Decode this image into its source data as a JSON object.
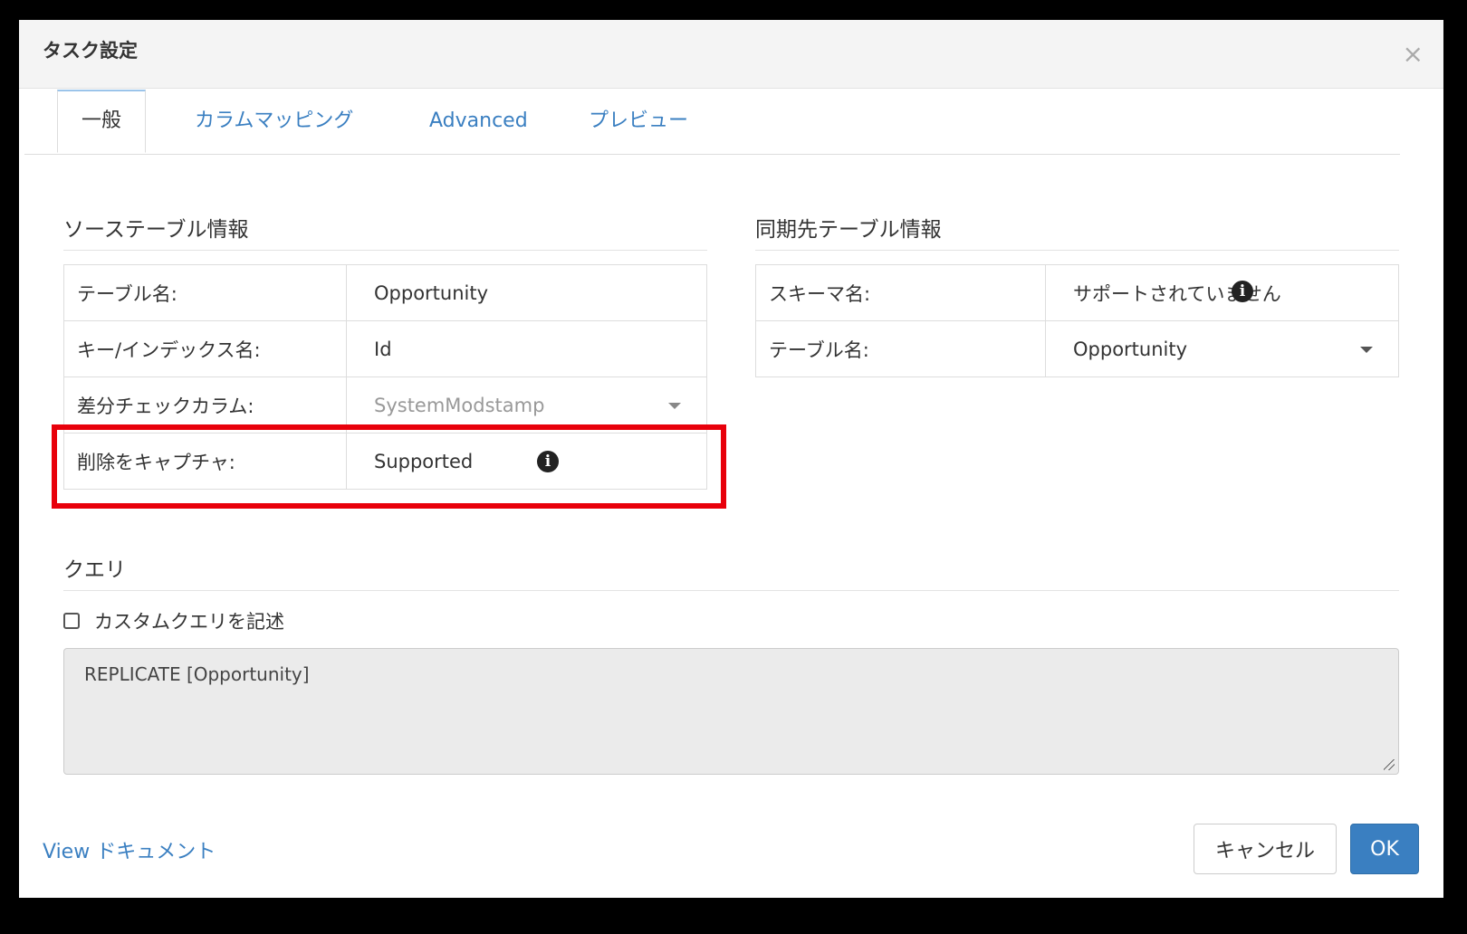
{
  "dialog": {
    "title": "タスク設定",
    "close_glyph": "×"
  },
  "tabs": [
    {
      "label": "一般"
    },
    {
      "label": "カラムマッピング"
    },
    {
      "label": "Advanced"
    },
    {
      "label": "プレビュー"
    }
  ],
  "source": {
    "title": "ソーステーブル情報",
    "rows": [
      {
        "label": "テーブル名:",
        "value": "Opportunity"
      },
      {
        "label": "キー/インデックス名:",
        "value": "Id"
      },
      {
        "label": "差分チェックカラム:",
        "value": "SystemModstamp"
      },
      {
        "label": "削除をキャプチャ:",
        "value": "Supported"
      }
    ]
  },
  "dest": {
    "title": "同期先テーブル情報",
    "rows": [
      {
        "label": "スキーマ名:",
        "value": "サポートされていません"
      },
      {
        "label": "テーブル名:",
        "value": "Opportunity"
      }
    ]
  },
  "query": {
    "title": "クエリ",
    "checkbox_label": "カスタムクエリを記述",
    "text": "REPLICATE [Opportunity]"
  },
  "footer": {
    "doc_link": "View ドキュメント",
    "cancel_label": "キャンセル",
    "ok_label": "OK"
  },
  "icons": {
    "info_glyph": "i"
  },
  "colors": {
    "accent": "#3a7fc1",
    "highlight": "#e8000b"
  }
}
